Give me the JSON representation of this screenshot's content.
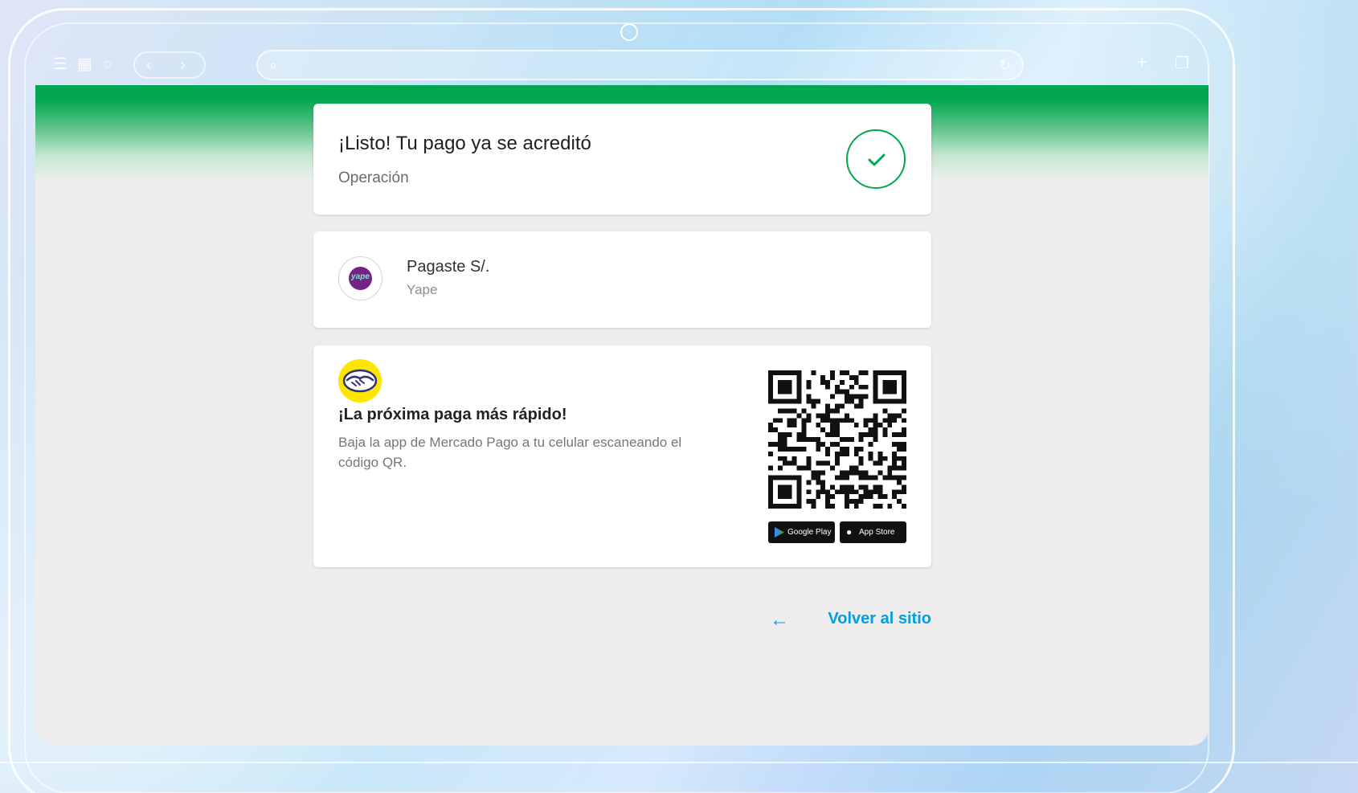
{
  "window": {
    "icons": [
      "menu-icon",
      "grid-icon",
      "back-icon",
      "forward-icon",
      "search-icon",
      "reload-icon",
      "new-tab-icon",
      "tabs-icon"
    ]
  },
  "colors": {
    "brand_green": "#00a650",
    "link_blue": "#009ee3",
    "background": "#ededed",
    "mp_yellow": "#ffe600",
    "yape_purple": "#742284"
  },
  "status_card": {
    "title": "¡Listo! Tu pago ya se acreditó",
    "subtitle": "Operación",
    "icon": "check-icon"
  },
  "payment_card": {
    "title": "Pagaste S/.",
    "method": "Yape",
    "logo_text": "yape"
  },
  "promo_card": {
    "title": "¡La próxima paga más rápido!",
    "description": "Baja la app de Mercado Pago a tu celular escaneando el código QR.",
    "stores": [
      {
        "label": "Google Play",
        "icon": "google-play-icon"
      },
      {
        "label": "App Store",
        "icon": "apple-icon"
      }
    ]
  },
  "footer": {
    "back_label": "Volver al sitio",
    "back_icon": "arrow-left-icon"
  }
}
